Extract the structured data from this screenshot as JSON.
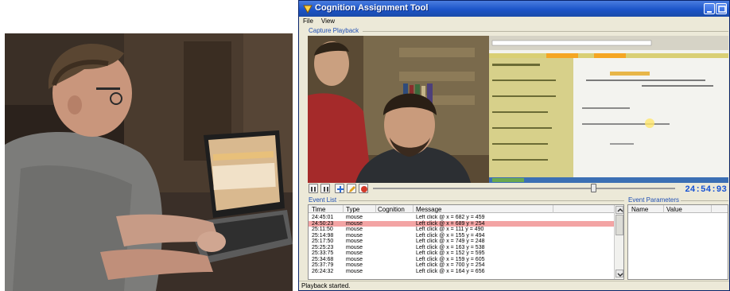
{
  "window": {
    "title": "Cognition Assignment Tool"
  },
  "menu": {
    "items": [
      "File",
      "View"
    ]
  },
  "capture": {
    "group_label": "Capture Playback",
    "time": "24:54:93",
    "progress": 0.73
  },
  "event_list": {
    "group_label": "Event List",
    "columns": [
      "Time",
      "Type",
      "Cognition",
      "Message"
    ],
    "rows": [
      {
        "time": "24:45:01",
        "type": "mouse",
        "cognition": "",
        "message": "Left click @ x = 682 y = 459",
        "selected": false
      },
      {
        "time": "24:50:23",
        "type": "mouse",
        "cognition": "",
        "message": "Left click @ x = 689 y = 254",
        "selected": true
      },
      {
        "time": "25:11:50",
        "type": "mouse",
        "cognition": "",
        "message": "Left click @ x = 111 y = 490",
        "selected": false
      },
      {
        "time": "25:14:98",
        "type": "mouse",
        "cognition": "",
        "message": "Left click @ x = 155 y = 494",
        "selected": false
      },
      {
        "time": "25:17:50",
        "type": "mouse",
        "cognition": "",
        "message": "Left click @ x = 749 y = 248",
        "selected": false
      },
      {
        "time": "25:25:23",
        "type": "mouse",
        "cognition": "",
        "message": "Left click @ x = 163 y = 538",
        "selected": false
      },
      {
        "time": "25:33:75",
        "type": "mouse",
        "cognition": "",
        "message": "Left click @ x = 152 y = 595",
        "selected": false
      },
      {
        "time": "25:34:68",
        "type": "mouse",
        "cognition": "",
        "message": "Left click @ x = 159 y = 605",
        "selected": false
      },
      {
        "time": "25:37:79",
        "type": "mouse",
        "cognition": "",
        "message": "Left click @ x = 700 y = 254",
        "selected": false
      },
      {
        "time": "26:24:32",
        "type": "mouse",
        "cognition": "",
        "message": "Left click @ x = 164 y = 656",
        "selected": false
      }
    ]
  },
  "event_parameters": {
    "group_label": "Event Parameters",
    "columns": [
      "Name",
      "Value"
    ]
  },
  "status": {
    "text": "Playback started."
  },
  "colors": {
    "accent": "#1f4fb4",
    "selected_row": "#f3a4a4",
    "time_display": "#1a55d4",
    "titlebar": "#1c54c8"
  }
}
